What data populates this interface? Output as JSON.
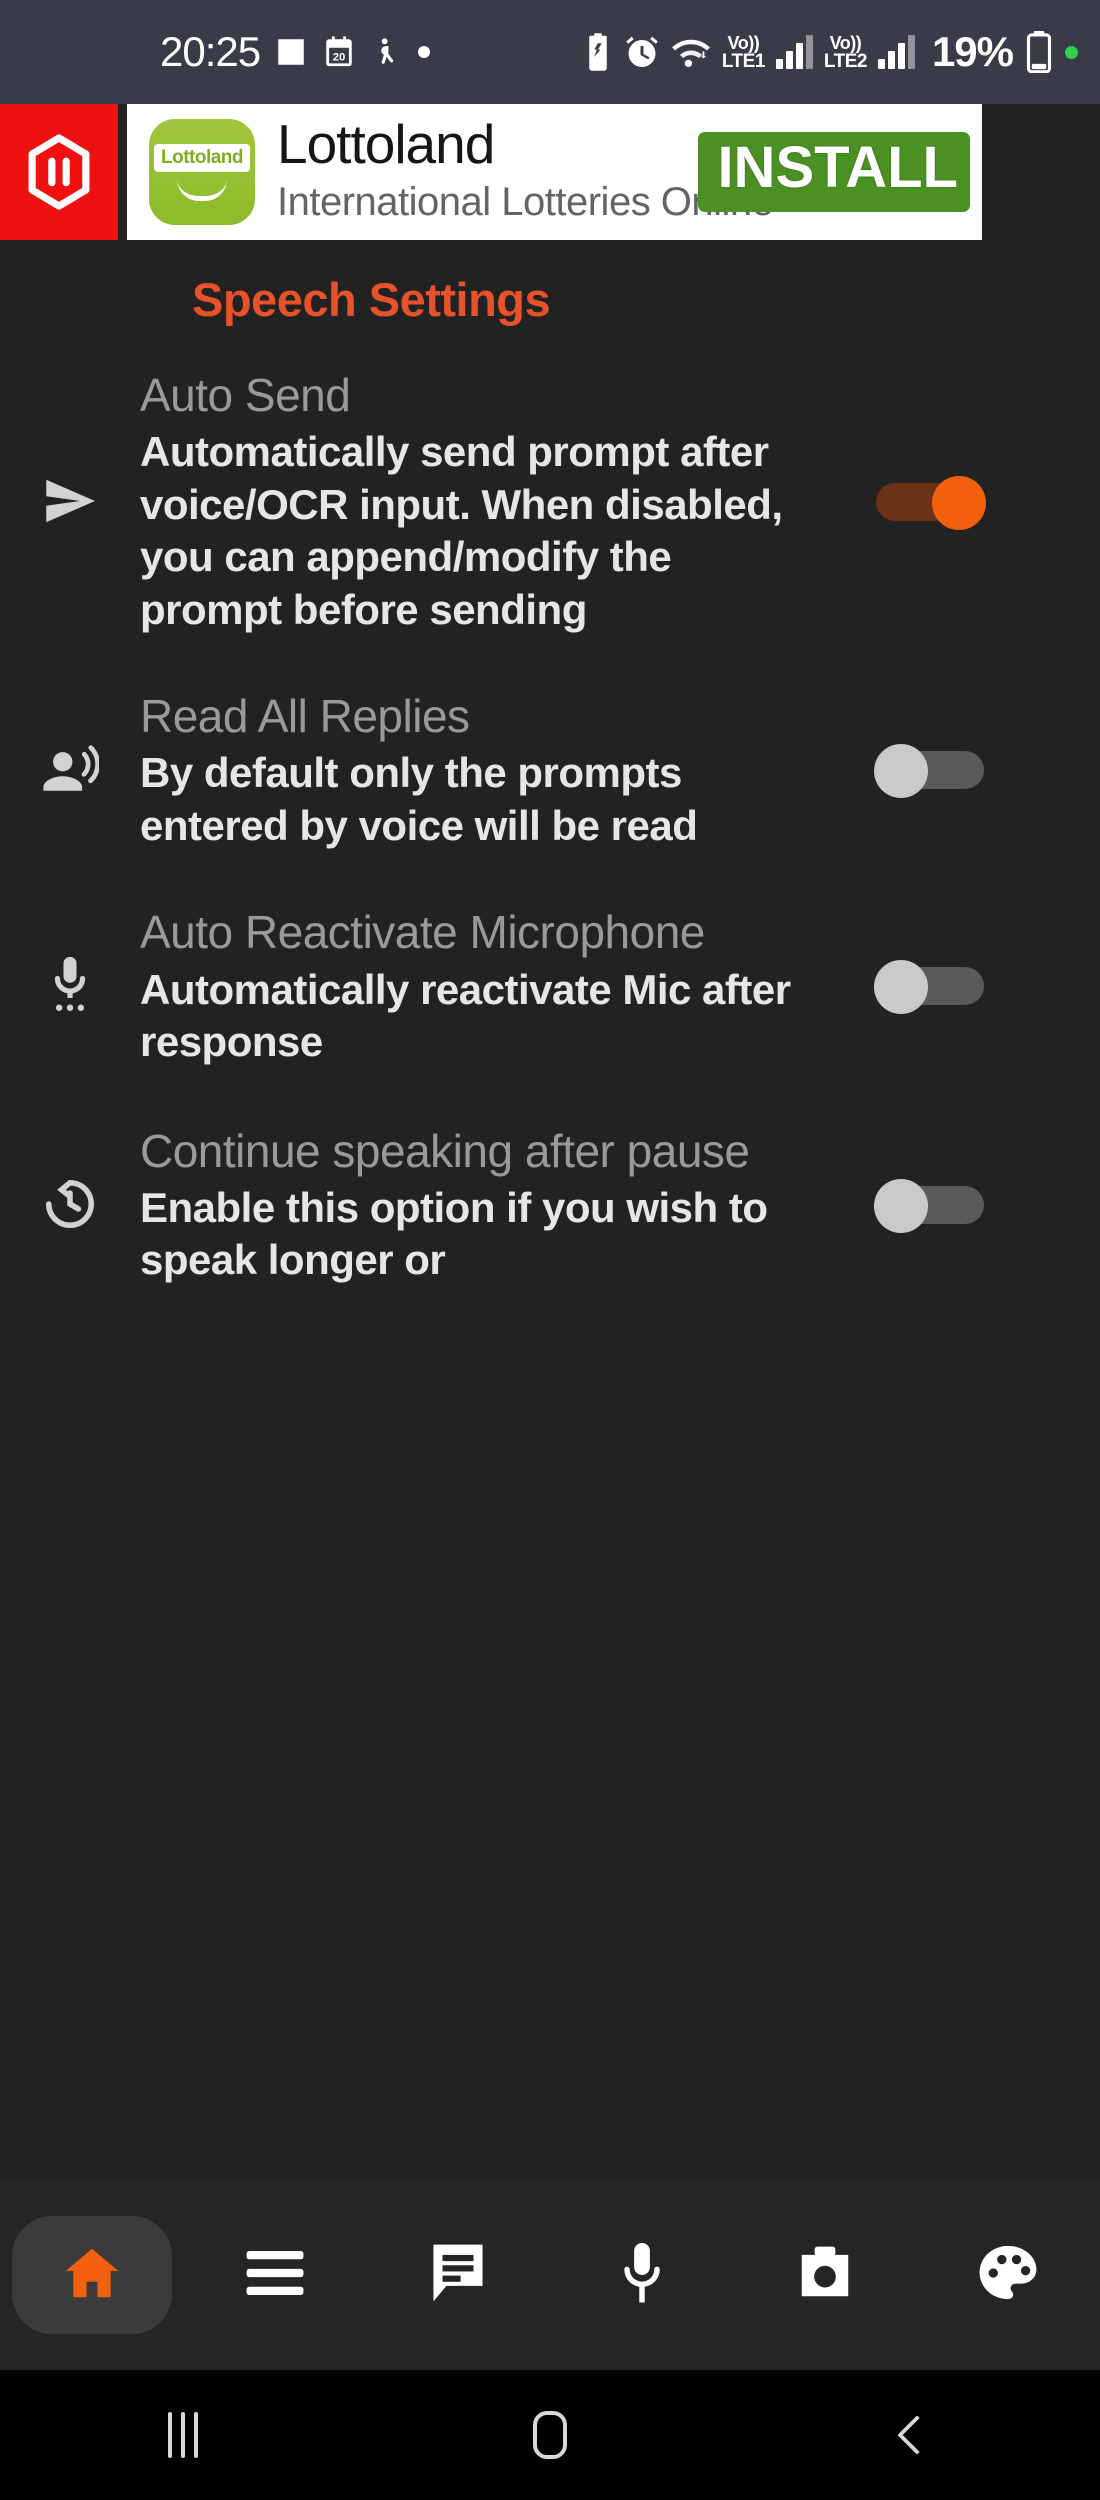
{
  "status_bar": {
    "time": "20:25",
    "left_icons": [
      "photo-icon",
      "calendar-20-icon",
      "accessibility-icon",
      "dot-icon"
    ],
    "calendar_day": "20",
    "right_icons": [
      "battery-saver-icon",
      "alarm-icon",
      "wifi-icon"
    ],
    "sim1_label_top": "Vo))",
    "sim1_label_bottom": "LTE1",
    "sim2_label_top": "Vo))",
    "sim2_label_bottom": "LTE2",
    "battery_percent": "19%",
    "battery_icon": "battery-icon",
    "recording_dot": "green-dot-icon",
    "background": "#3a3b49"
  },
  "ad": {
    "network_icon": "hexagon-pause-icon",
    "network_icon_background": "#ef1010",
    "app_icon_label": "Lottoland",
    "title": "Lottoland",
    "subtitle": "International Lotteries Online",
    "install_label": "INSTALL",
    "install_color": "#4b9022"
  },
  "page": {
    "title": "Speech Settings",
    "title_color": "#e8522a",
    "background": "#222222"
  },
  "settings": [
    {
      "icon": "send-icon",
      "title": "Auto Send",
      "description": "Automatically send prompt after voice/OCR input. When disabled, you can append/modify the prompt before sending",
      "toggle_state": "on",
      "toggle_on_color": "#f3600d"
    },
    {
      "icon": "record-voice-over-icon",
      "title": "Read All Replies",
      "description": "By default only the prompts entered by voice will be read",
      "toggle_state": "off",
      "toggle_off_color": "#c9c9c9"
    },
    {
      "icon": "settings-voice-icon",
      "title": "Auto Reactivate Microphone",
      "description": "Automatically reactivate Mic after response",
      "toggle_state": "off",
      "toggle_off_color": "#c9c9c9"
    },
    {
      "icon": "history-icon",
      "title": "Continue speaking after pause",
      "description": "Enable this option if you wish to speak longer or",
      "toggle_state": "off",
      "toggle_off_color": "#c9c9c9"
    }
  ],
  "bottom_nav": {
    "items": [
      {
        "icon": "home-icon",
        "name": "home",
        "active": true,
        "color": "#f3600d"
      },
      {
        "icon": "menu-icon",
        "name": "menu",
        "active": false,
        "color": "#ffffff"
      },
      {
        "icon": "chat-icon",
        "name": "chat",
        "active": false,
        "color": "#ffffff"
      },
      {
        "icon": "microphone-icon",
        "name": "microphone",
        "active": false,
        "color": "#ffffff"
      },
      {
        "icon": "camera-icon",
        "name": "camera",
        "active": false,
        "color": "#ffffff"
      },
      {
        "icon": "palette-icon",
        "name": "palette",
        "active": false,
        "color": "#ffffff"
      }
    ]
  },
  "system_nav": {
    "items": [
      "recents-icon",
      "home-icon",
      "back-icon"
    ],
    "background": "#000000"
  }
}
